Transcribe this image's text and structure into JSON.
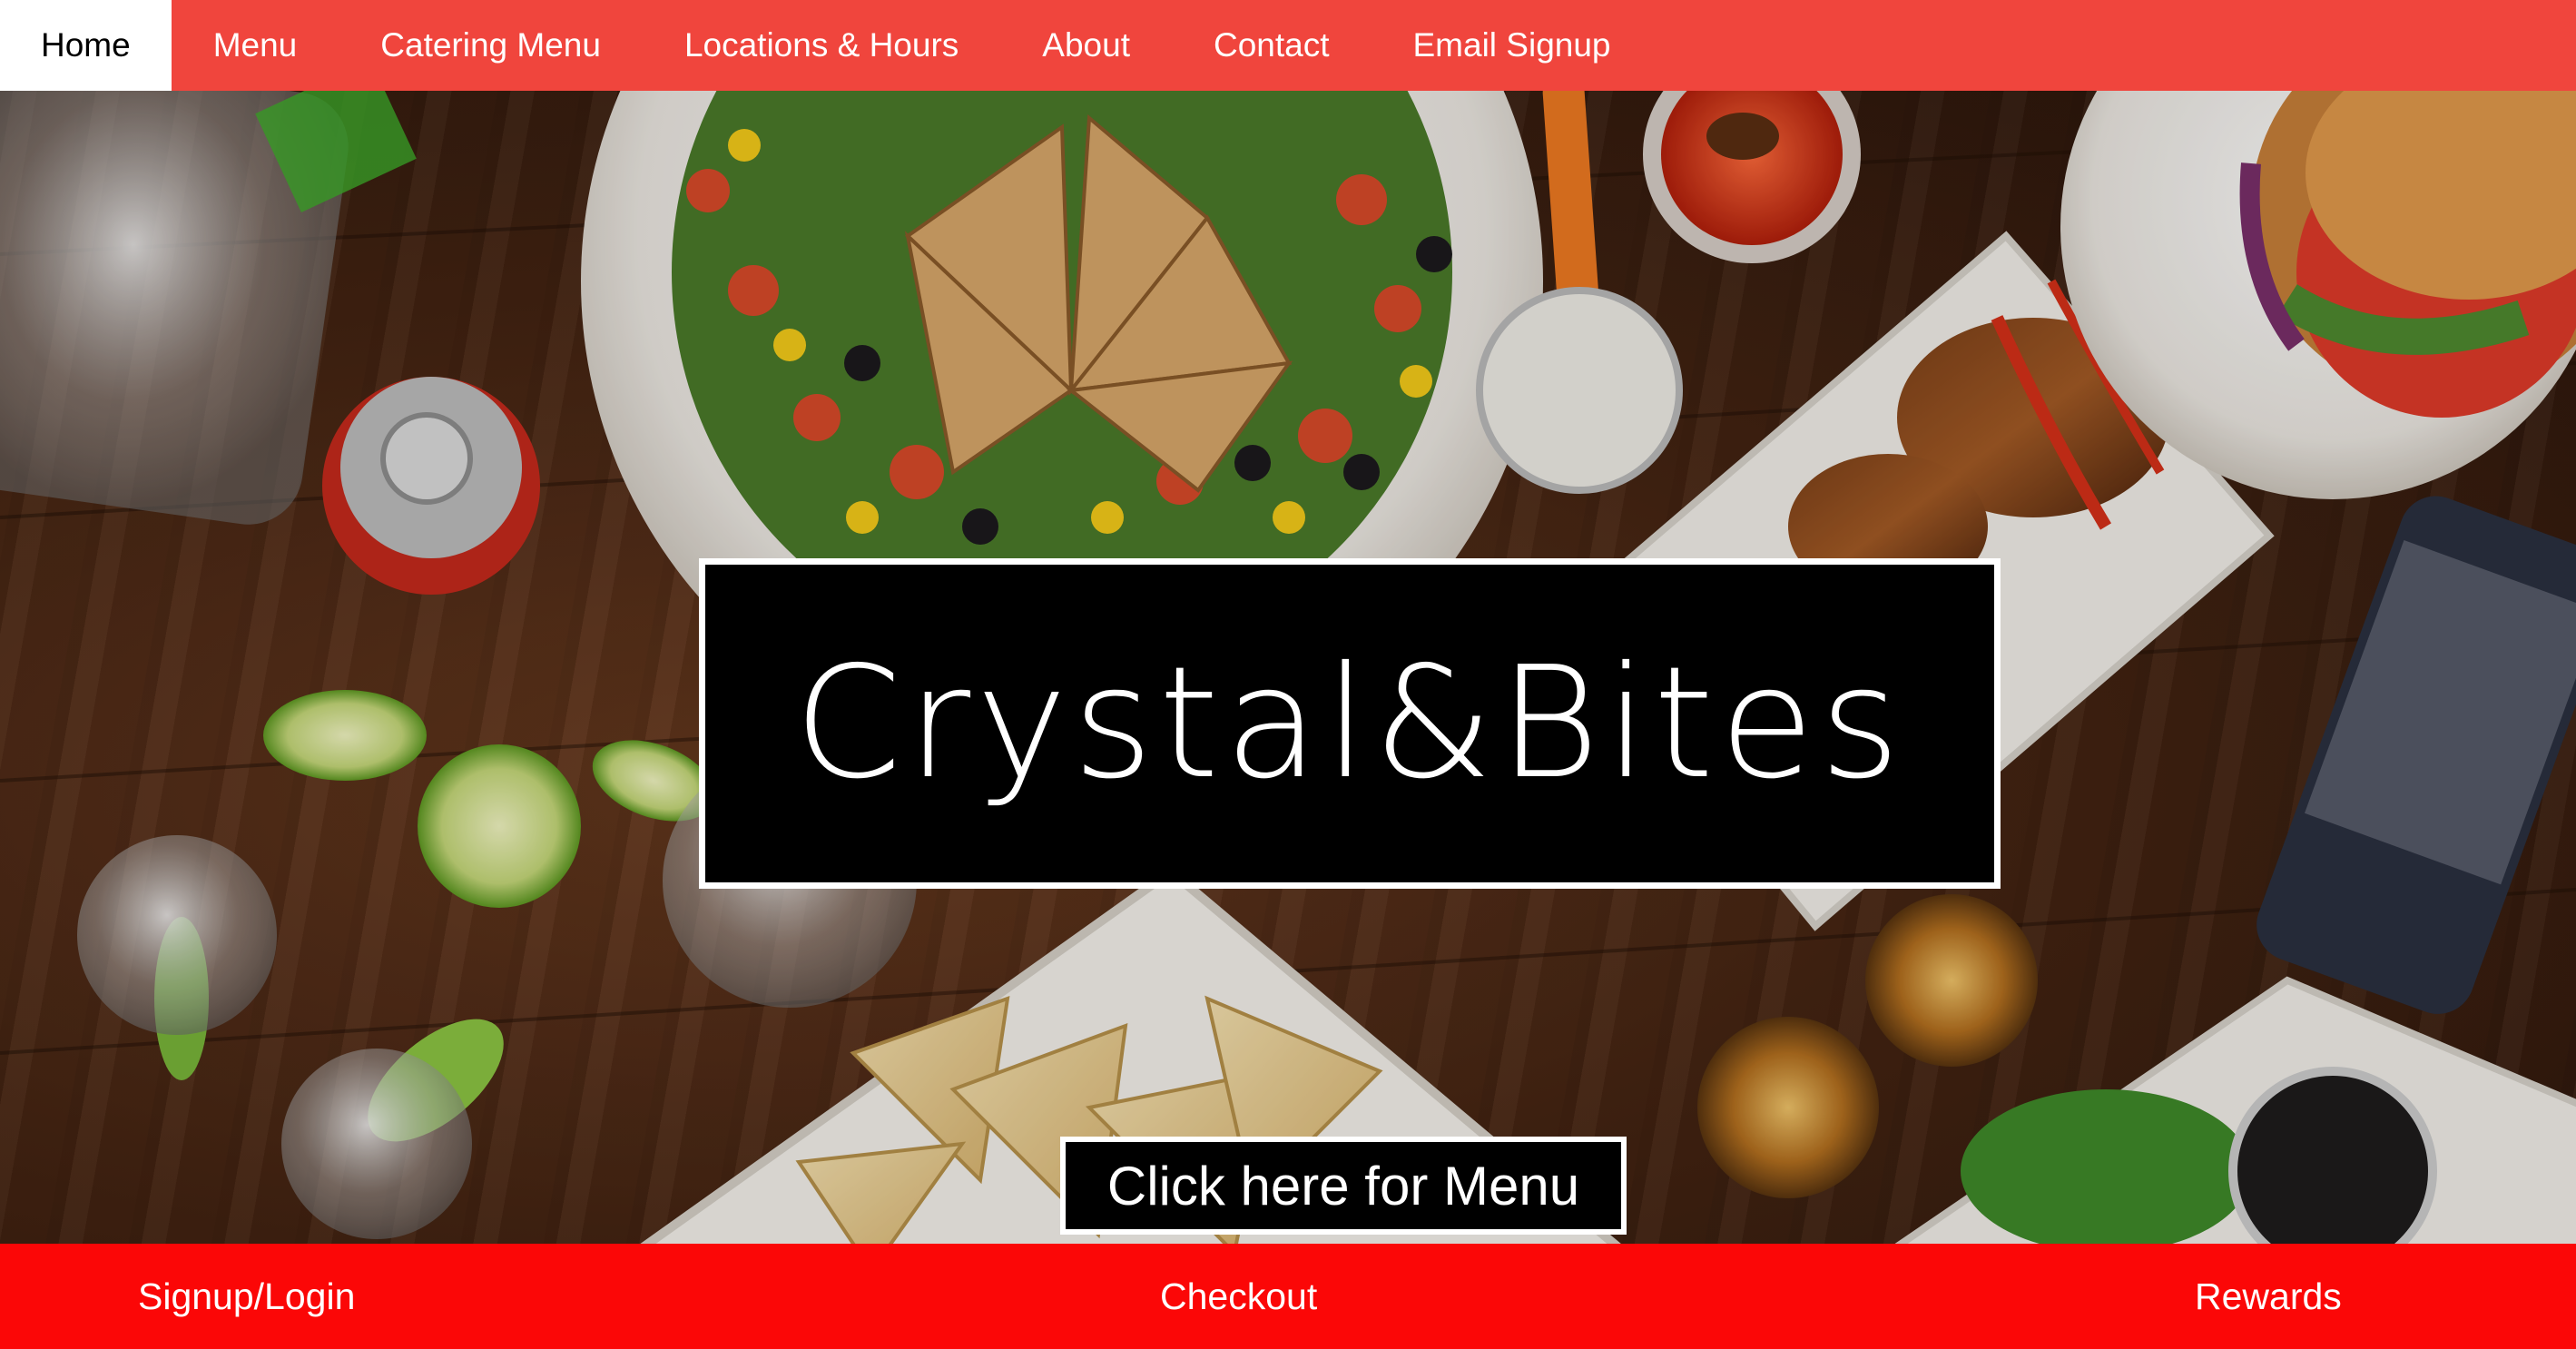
{
  "nav": {
    "items": [
      {
        "label": "Home",
        "active": true
      },
      {
        "label": "Menu",
        "active": false
      },
      {
        "label": "Catering Menu",
        "active": false
      },
      {
        "label": "Locations & Hours",
        "active": false
      },
      {
        "label": "About",
        "active": false
      },
      {
        "label": "Contact",
        "active": false
      },
      {
        "label": "Email Signup",
        "active": false
      }
    ]
  },
  "hero": {
    "title": "Crystal&Bites",
    "cta_label": "Click here for Menu",
    "background_icon": "food-table-photo"
  },
  "bottom_bar": {
    "signup_label": "Signup/Login",
    "checkout_label": "Checkout",
    "rewards_label": "Rewards"
  },
  "colors": {
    "nav_background": "#f0453d",
    "nav_active_background": "#ffffff",
    "bottom_bar_background": "#fb0707",
    "title_box_background": "#000000",
    "title_box_border": "#ffffff"
  }
}
